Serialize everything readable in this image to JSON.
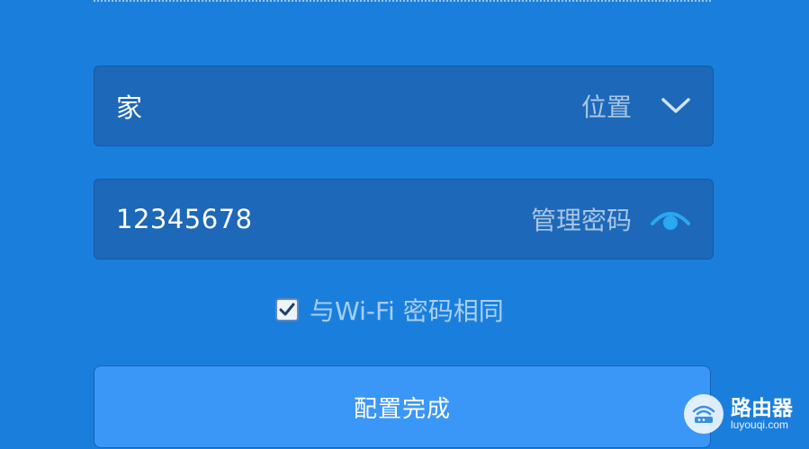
{
  "form": {
    "location": {
      "value": "家",
      "label": "位置",
      "icon": "chevron-down-icon"
    },
    "admin_password": {
      "value": "12345678",
      "label": "管理密码",
      "icon": "eye-icon"
    },
    "same_as_wifi": {
      "checked": true,
      "label": "与Wi-Fi 密码相同"
    },
    "submit": {
      "label": "配置完成"
    }
  },
  "watermark": {
    "name": "路由器",
    "url": "luyouqi.com"
  },
  "colors": {
    "background": "#1a7fdc",
    "field": "#1d68b8",
    "button": "#3a97f7",
    "eye_accent": "#2aa8f2"
  }
}
